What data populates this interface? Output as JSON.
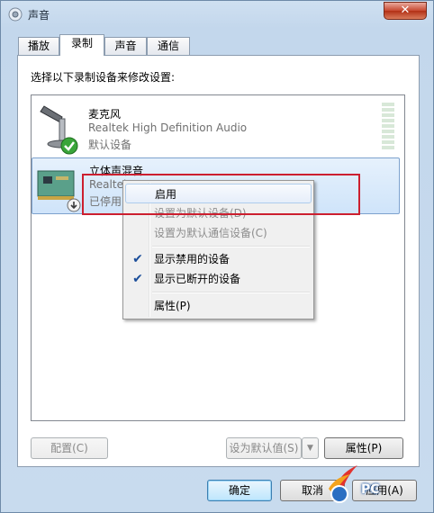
{
  "window": {
    "title": "声音",
    "close_label": "✕"
  },
  "tabs": [
    {
      "label": "播放",
      "active": false
    },
    {
      "label": "录制",
      "active": true
    },
    {
      "label": "声音",
      "active": false
    },
    {
      "label": "通信",
      "active": false
    }
  ],
  "recording": {
    "instruction": "选择以下录制设备来修改设置:",
    "devices": [
      {
        "name": "麦克风",
        "driver": "Realtek High Definition Audio",
        "status": "默认设备",
        "status_icon": "green-check-icon",
        "device_icon": "microphone-icon"
      },
      {
        "name": "立体声混音",
        "driver": "Realtek",
        "status": "已停用",
        "status_icon": "down-arrow-icon",
        "device_icon": "sound-card-icon"
      }
    ]
  },
  "context_menu": {
    "items": [
      {
        "label": "启用",
        "disabled": false,
        "checked": false,
        "highlighted": true
      },
      {
        "label": "设置为默认设备(D)",
        "disabled": true,
        "checked": false
      },
      {
        "label": "设置为默认通信设备(C)",
        "disabled": true,
        "checked": false
      },
      {
        "label": "显示禁用的设备",
        "disabled": false,
        "checked": true
      },
      {
        "label": "显示已断开的设备",
        "disabled": false,
        "checked": true
      },
      {
        "label": "属性(P)",
        "disabled": false,
        "checked": false
      }
    ]
  },
  "buttons": {
    "configure": "配置(C)",
    "set_default": "设为默认值(S)",
    "properties": "属性(P)",
    "ok": "确定",
    "cancel": "取消",
    "apply": "应用(A)"
  },
  "colors": {
    "highlight_box": "#cc1f2f",
    "check_mark": "#1b4e9a",
    "status_green": "#3aa53a"
  }
}
